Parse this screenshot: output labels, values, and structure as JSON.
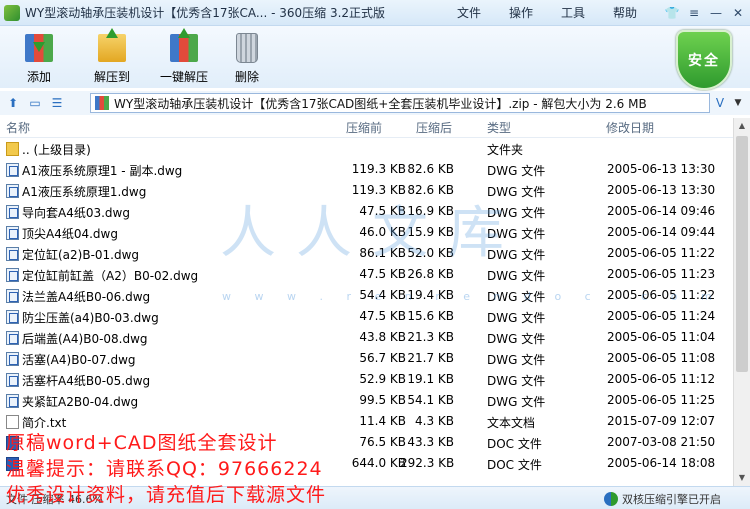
{
  "window": {
    "title": "WY型滚动轴承压装机设计【优秀含17张CA... - 360压缩 3.2正式版",
    "menu": [
      "文件",
      "操作",
      "工具",
      "帮助"
    ],
    "controls": {
      "skin": "👕",
      "menu": "≡",
      "minimize": "—",
      "close": "✕"
    }
  },
  "toolbar": {
    "add_label": "添加",
    "extract_label": "解压到",
    "one_click_label": "一键解压",
    "delete_label": "删除",
    "security_label": "安全"
  },
  "addressbar": {
    "path": "WY型滚动轴承压装机设计【优秀含17张CAD图纸+全套压装机毕业设计】.zip - 解包大小为 2.6 MB",
    "dropdown_icon": "V"
  },
  "columns": {
    "name": "名称",
    "orig": "压缩前",
    "comp": "压缩后",
    "type": "类型",
    "date": "修改日期"
  },
  "files": [
    {
      "name": ".. (上级目录)",
      "orig": "",
      "comp": "",
      "type": "文件夹",
      "date": "",
      "icon": "folder"
    },
    {
      "name": "A1液压系统原理1 - 副本.dwg",
      "orig": "119.3 KB",
      "comp": "82.6 KB",
      "type": "DWG 文件",
      "date": "2005-06-13 13:30",
      "icon": "dwg"
    },
    {
      "name": "A1液压系统原理1.dwg",
      "orig": "119.3 KB",
      "comp": "82.6 KB",
      "type": "DWG 文件",
      "date": "2005-06-13 13:30",
      "icon": "dwg"
    },
    {
      "name": "导向套A4纸03.dwg",
      "orig": "47.5 KB",
      "comp": "16.9 KB",
      "type": "DWG 文件",
      "date": "2005-06-14 09:46",
      "icon": "dwg"
    },
    {
      "name": "顶尖A4纸04.dwg",
      "orig": "46.0 KB",
      "comp": "15.9 KB",
      "type": "DWG 文件",
      "date": "2005-06-14 09:44",
      "icon": "dwg"
    },
    {
      "name": "定位缸(a2)B-01.dwg",
      "orig": "86.1 KB",
      "comp": "52.0 KB",
      "type": "DWG 文件",
      "date": "2005-06-05 11:22",
      "icon": "dwg"
    },
    {
      "name": "定位缸前缸盖（A2）B0-02.dwg",
      "orig": "47.5 KB",
      "comp": "26.8 KB",
      "type": "DWG 文件",
      "date": "2005-06-05 11:23",
      "icon": "dwg"
    },
    {
      "name": "法兰盖A4纸B0-06.dwg",
      "orig": "54.4 KB",
      "comp": "19.4 KB",
      "type": "DWG 文件",
      "date": "2005-06-05 11:22",
      "icon": "dwg"
    },
    {
      "name": "防尘压盖(a4)B0-03.dwg",
      "orig": "47.5 KB",
      "comp": "15.6 KB",
      "type": "DWG 文件",
      "date": "2005-06-05 11:24",
      "icon": "dwg"
    },
    {
      "name": "后端盖(A4)B0-08.dwg",
      "orig": "43.8 KB",
      "comp": "21.3 KB",
      "type": "DWG 文件",
      "date": "2005-06-05 11:04",
      "icon": "dwg"
    },
    {
      "name": "活塞(A4)B0-07.dwg",
      "orig": "56.7 KB",
      "comp": "21.7 KB",
      "type": "DWG 文件",
      "date": "2005-06-05 11:08",
      "icon": "dwg"
    },
    {
      "name": "活塞杆A4纸B0-05.dwg",
      "orig": "52.9 KB",
      "comp": "19.1 KB",
      "type": "DWG 文件",
      "date": "2005-06-05 11:12",
      "icon": "dwg"
    },
    {
      "name": "夹紧缸A2B0-04.dwg",
      "orig": "99.5 KB",
      "comp": "54.1 KB",
      "type": "DWG 文件",
      "date": "2005-06-05 11:25",
      "icon": "dwg"
    },
    {
      "name": "简介.txt",
      "orig": "11.4 KB",
      "comp": "4.3 KB",
      "type": "文本文档",
      "date": "2015-07-09 12:07",
      "icon": "txt"
    },
    {
      "name": "",
      "orig": "76.5 KB",
      "comp": "43.3 KB",
      "type": "DOC 文件",
      "date": "2007-03-08 21:50",
      "icon": "doc"
    },
    {
      "name": "",
      "orig": "644.0 KB",
      "comp": "292.3 KB",
      "type": "DOC 文件",
      "date": "2005-06-14 18:08",
      "icon": "doc"
    }
  ],
  "status": {
    "left": "文件 压缩率 46.6%",
    "engine": "双核压缩引擎已开启"
  },
  "watermark": {
    "text": "人人文库",
    "sub": "w w w . r e n r e n d o c . c o m"
  },
  "overlay": {
    "line1": "原稿word+CAD图纸全套设计",
    "line2": "温馨提示：请联系QQ：97666224",
    "line3": "优秀设计资料，请充值后下载源文件"
  }
}
